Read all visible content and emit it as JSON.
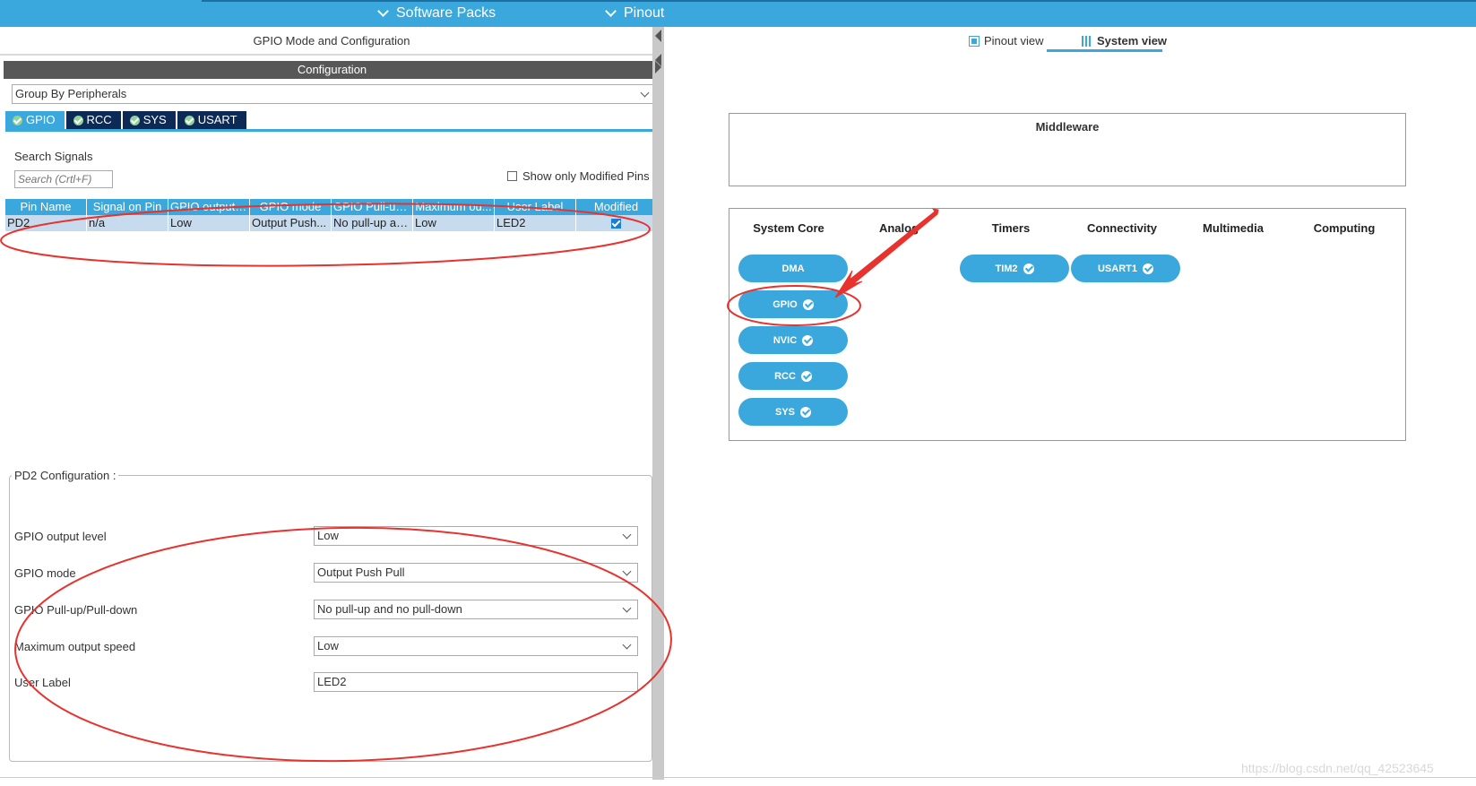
{
  "topbar": {
    "menus": [
      "Software Packs",
      "Pinout"
    ]
  },
  "left": {
    "title": "GPIO Mode and Configuration",
    "config_header": "Configuration",
    "group_select": "Group By Peripherals",
    "tabs": [
      "GPIO",
      "RCC",
      "SYS",
      "USART"
    ],
    "search_label": "Search Signals",
    "search_placeholder": "Search (Crtl+F)",
    "show_modified": "Show only Modified Pins",
    "table": {
      "headers": [
        "Pin Name",
        "Signal on Pin",
        "GPIO output ...",
        "GPIO mode",
        "GPIO Pull-up...",
        "Maximum ou...",
        "User Label",
        "Modified"
      ],
      "rows": [
        [
          "PD2",
          "n/a",
          "Low",
          "Output Push...",
          "No pull-up an...",
          "Low",
          "LED2",
          ""
        ]
      ]
    },
    "pd2_legend": "PD2 Configuration :",
    "fields": {
      "output_level": {
        "label": "GPIO output level",
        "value": "Low"
      },
      "mode": {
        "label": "GPIO mode",
        "value": "Output Push Pull"
      },
      "pull": {
        "label": "GPIO Pull-up/Pull-down",
        "value": "No pull-up and no pull-down"
      },
      "speed": {
        "label": "Maximum output speed",
        "value": "Low"
      },
      "user_label": {
        "label": "User Label",
        "value": "LED2"
      }
    }
  },
  "right": {
    "tabs": {
      "pinout": "Pinout view",
      "system": "System view"
    },
    "middleware_title": "Middleware",
    "categories": [
      "System Core",
      "Analog",
      "Timers",
      "Connectivity",
      "Multimedia",
      "Computing"
    ],
    "system_core": [
      "DMA",
      "GPIO",
      "NVIC",
      "RCC",
      "SYS"
    ],
    "timers": [
      "TIM2"
    ],
    "connectivity": [
      "USART1"
    ]
  },
  "watermark": "https://blog.csdn.net/qq_42523645",
  "colors": {
    "accent": "#3aa8dc",
    "tab_dark": "#0c2a55",
    "annotation": "#e8322e"
  }
}
